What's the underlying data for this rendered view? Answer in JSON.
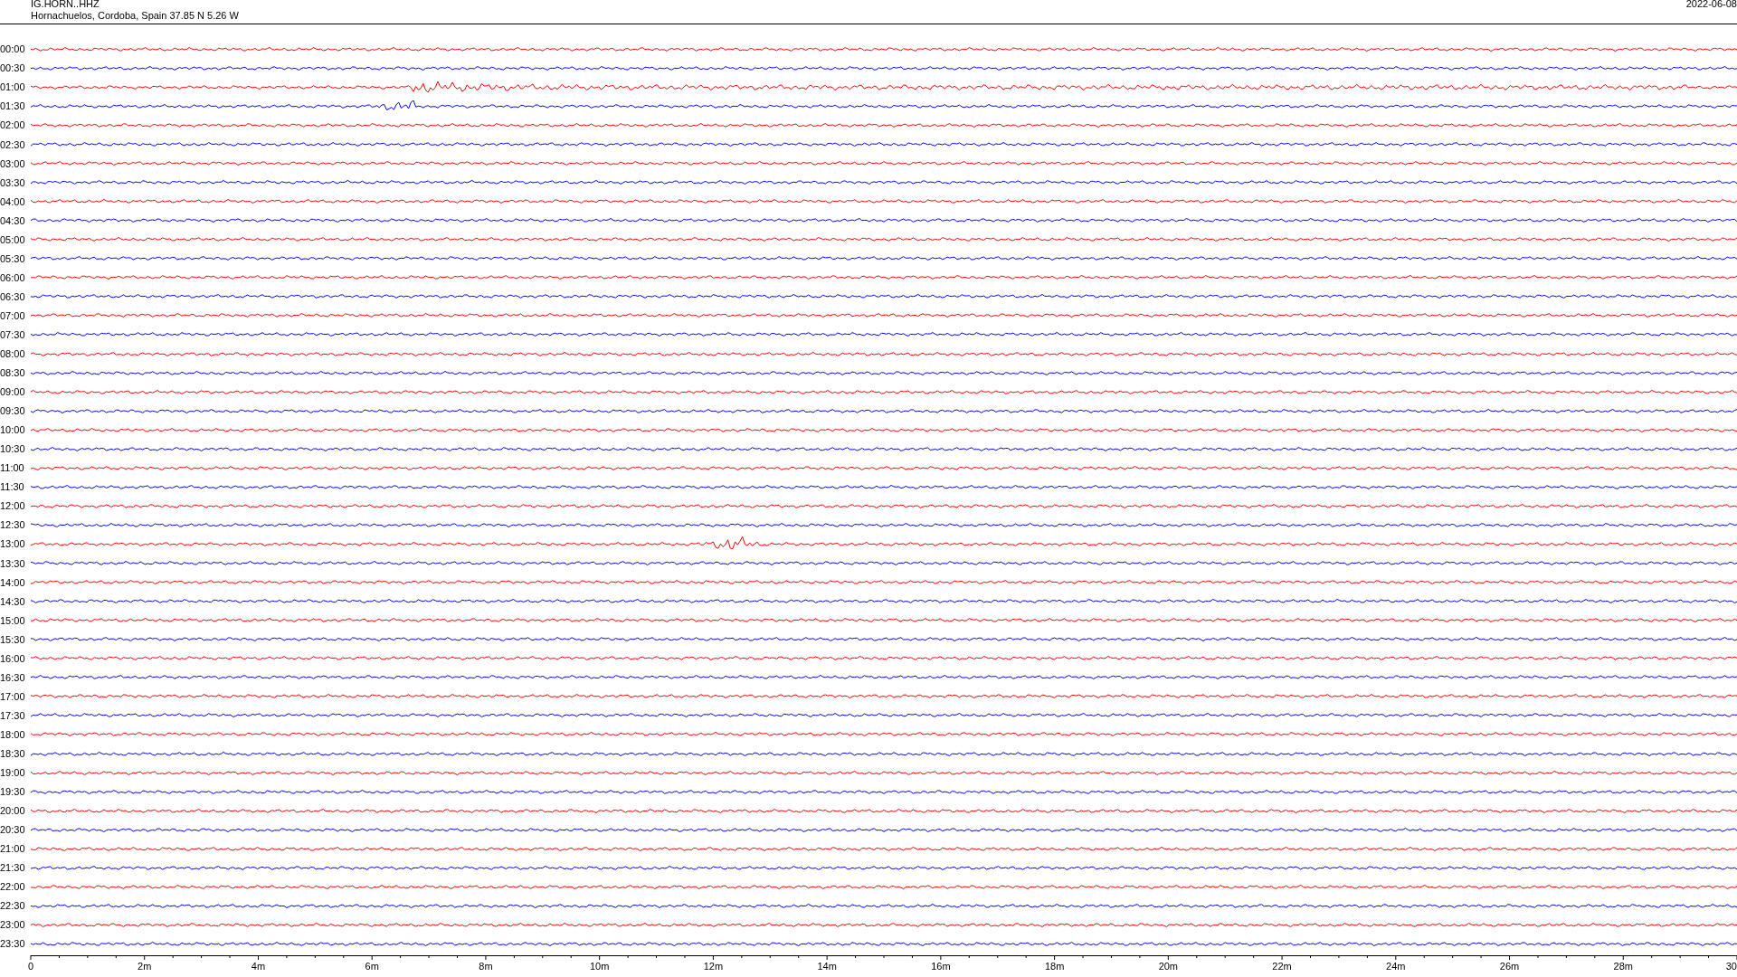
{
  "header": {
    "station": "IG.HORN..HHZ",
    "location": "Hornachuelos, Cordoba, Spain  37.85 N 5.26 W",
    "date": "2022-06-08"
  },
  "rows": [
    {
      "label": "00:00",
      "color": "#ff0000"
    },
    {
      "label": "00:30",
      "color": "#0000ff"
    },
    {
      "label": "01:00",
      "color": "#ff0000"
    },
    {
      "label": "01:30",
      "color": "#0000ff"
    },
    {
      "label": "02:00",
      "color": "#ff0000"
    },
    {
      "label": "02:30",
      "color": "#0000ff"
    },
    {
      "label": "03:00",
      "color": "#ff0000"
    },
    {
      "label": "03:30",
      "color": "#0000ff"
    },
    {
      "label": "04:00",
      "color": "#ff0000"
    },
    {
      "label": "04:30",
      "color": "#0000ff"
    },
    {
      "label": "05:00",
      "color": "#ff0000"
    },
    {
      "label": "05:30",
      "color": "#0000ff"
    },
    {
      "label": "06:00",
      "color": "#ff0000"
    },
    {
      "label": "06:30",
      "color": "#0000ff"
    },
    {
      "label": "07:00",
      "color": "#ff0000"
    },
    {
      "label": "07:30",
      "color": "#0000ff"
    },
    {
      "label": "08:00",
      "color": "#ff0000"
    },
    {
      "label": "08:30",
      "color": "#0000ff"
    },
    {
      "label": "09:00",
      "color": "#ff0000"
    },
    {
      "label": "09:30",
      "color": "#0000ff"
    },
    {
      "label": "10:00",
      "color": "#ff0000"
    },
    {
      "label": "10:30",
      "color": "#0000ff"
    },
    {
      "label": "11:00",
      "color": "#ff0000"
    },
    {
      "label": "11:30",
      "color": "#0000ff"
    },
    {
      "label": "12:00",
      "color": "#ff0000"
    },
    {
      "label": "12:30",
      "color": "#0000ff"
    },
    {
      "label": "13:00",
      "color": "#ff0000"
    },
    {
      "label": "13:30",
      "color": "#0000ff"
    },
    {
      "label": "14:00",
      "color": "#ff0000"
    },
    {
      "label": "14:30",
      "color": "#0000ff"
    },
    {
      "label": "15:00",
      "color": "#ff0000"
    },
    {
      "label": "15:30",
      "color": "#0000ff"
    },
    {
      "label": "16:00",
      "color": "#ff0000"
    },
    {
      "label": "16:30",
      "color": "#0000ff"
    },
    {
      "label": "17:00",
      "color": "#ff0000"
    },
    {
      "label": "17:30",
      "color": "#0000ff"
    },
    {
      "label": "18:00",
      "color": "#ff0000"
    },
    {
      "label": "18:30",
      "color": "#0000ff"
    },
    {
      "label": "19:00",
      "color": "#ff0000"
    },
    {
      "label": "19:30",
      "color": "#0000ff"
    },
    {
      "label": "20:00",
      "color": "#ff0000"
    },
    {
      "label": "20:30",
      "color": "#0000ff"
    },
    {
      "label": "21:00",
      "color": "#ff0000"
    },
    {
      "label": "21:30",
      "color": "#0000ff"
    },
    {
      "label": "22:00",
      "color": "#ff0000"
    },
    {
      "label": "22:30",
      "color": "#0000ff"
    },
    {
      "label": "23:00",
      "color": "#ff0000"
    },
    {
      "label": "23:30",
      "color": "#0000ff"
    }
  ],
  "time_axis": {
    "labels": [
      "0",
      "2m",
      "4m",
      "6m",
      "8m",
      "10m",
      "12m",
      "14m",
      "16m",
      "18m",
      "20m",
      "22m",
      "24m",
      "26m",
      "28m",
      "30"
    ]
  }
}
